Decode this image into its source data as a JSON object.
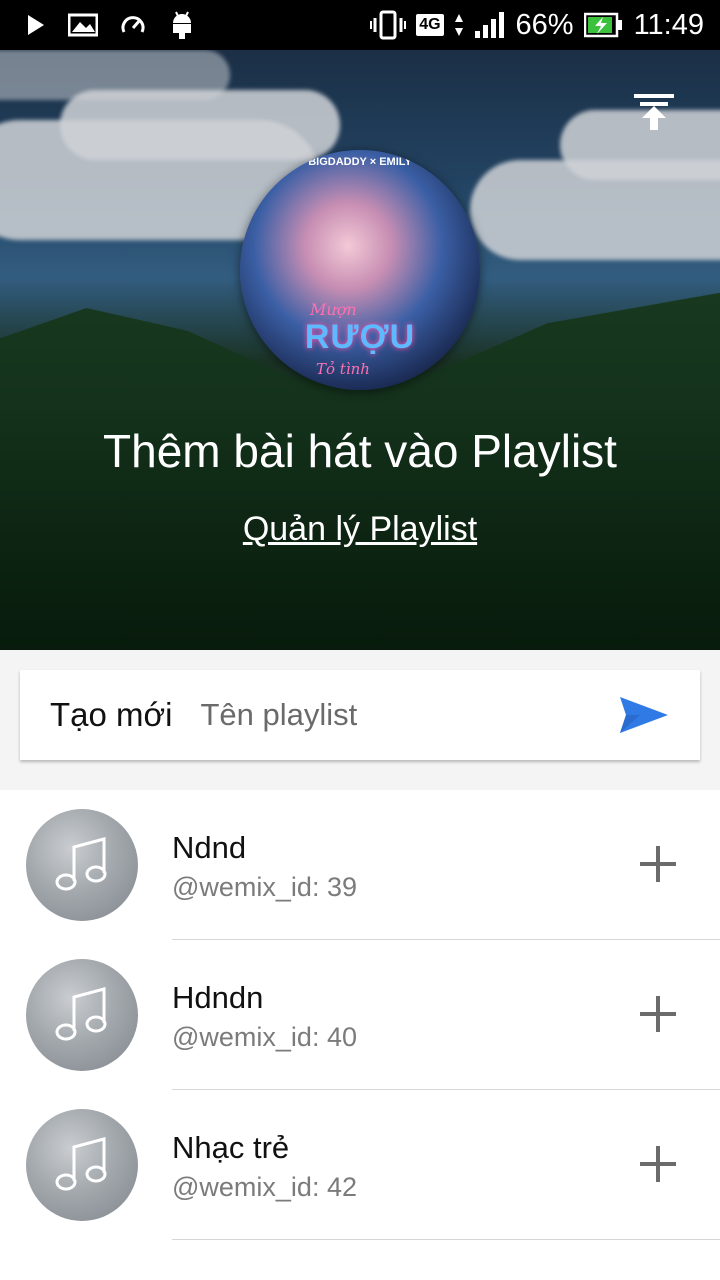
{
  "status_bar": {
    "battery": "66%",
    "time": "11:49",
    "network": "4G"
  },
  "hero": {
    "title": "Thêm bài hát vào Playlist",
    "manage_link": "Quản lý Playlist",
    "cover_art": {
      "top_text": "BIGDADDY × EMILY",
      "line1": "Mượn",
      "title": "RƯỢU",
      "line2": "Tỏ tình"
    }
  },
  "create": {
    "label": "Tạo mới",
    "placeholder": "Tên playlist",
    "value": ""
  },
  "playlists": [
    {
      "name": "Ndnd",
      "id": "@wemix_id: 39"
    },
    {
      "name": "Hdndn",
      "id": "@wemix_id: 40"
    },
    {
      "name": "Nhạc trẻ",
      "id": "@wemix_id: 42"
    }
  ],
  "colors": {
    "accent": "#2f7ae5",
    "icon_gray": "#6b6b6b"
  },
  "icons": {
    "sort": "sort-to-top-icon",
    "send": "send-icon",
    "add": "plus-icon",
    "thumb": "music-note-icon"
  }
}
